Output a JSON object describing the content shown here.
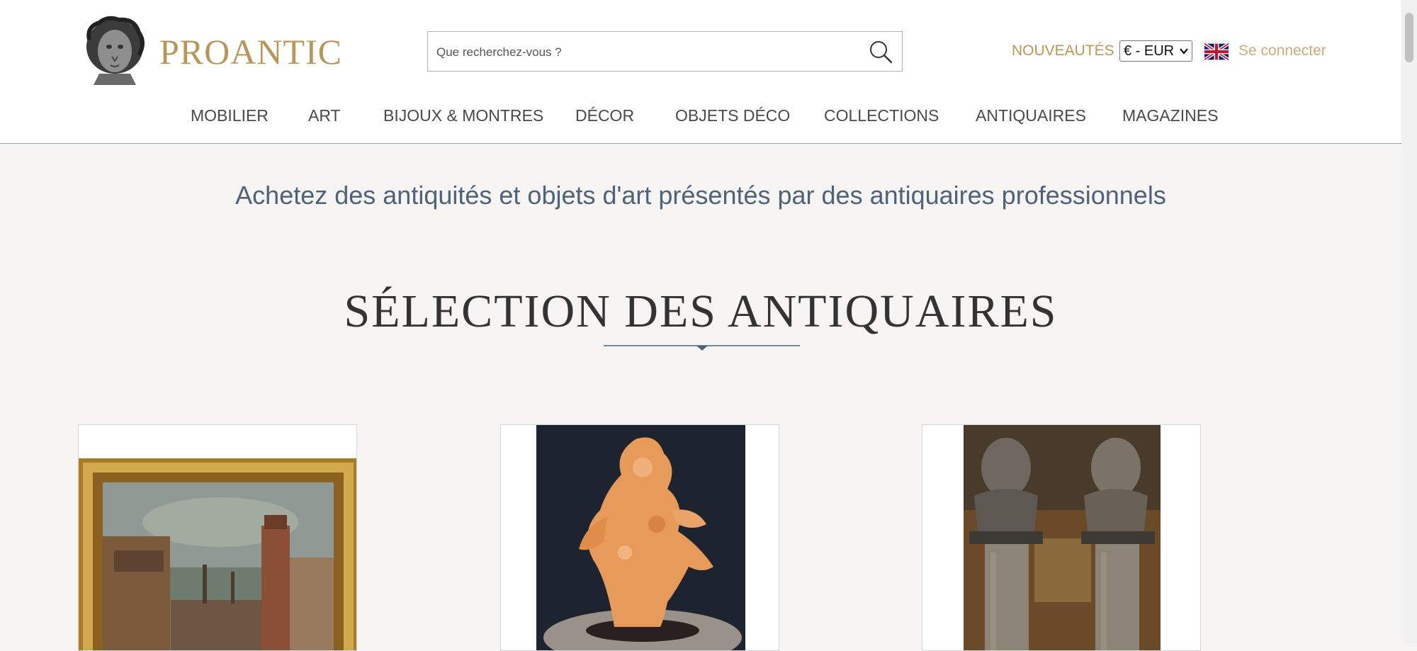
{
  "brand": {
    "name": "PROANTIC"
  },
  "search": {
    "placeholder": "Que recherchez-vous ?"
  },
  "header": {
    "new_label": "NOUVEAUTÉS",
    "currency_label": "€ - EUR",
    "login_label": "Se connecter"
  },
  "nav": [
    "MOBILIER",
    "ART",
    "BIJOUX & MONTRES",
    "DÉCOR",
    "OBJETS DÉCO",
    "COLLECTIONS",
    "ANTIQUAIRES",
    "MAGAZINES"
  ],
  "tagline": "Achetez des antiquités et objets d'art présentés par des antiquaires professionnels",
  "section": {
    "title": "SÉLECTION DES ANTIQUAIRES"
  },
  "colors": {
    "accent_gold": "#b8975a",
    "nav_text": "#4a4a4a",
    "tagline_blue": "#4f6278",
    "page_bg": "#f6f5f3"
  },
  "icons": [
    "bust-logo-icon",
    "search-icon",
    "chevron-down-icon",
    "uk-flag-icon"
  ]
}
